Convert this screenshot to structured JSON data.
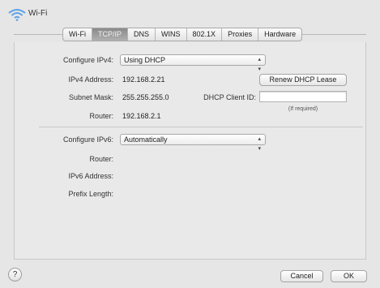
{
  "header": {
    "title": "Wi-Fi",
    "icon": "wifi-icon"
  },
  "tabs": [
    "Wi-Fi",
    "TCP/IP",
    "DNS",
    "WINS",
    "802.1X",
    "Proxies",
    "Hardware"
  ],
  "active_tab": "TCP/IP",
  "ipv4": {
    "configure_label": "Configure IPv4:",
    "configure_value": "Using DHCP",
    "address_label": "IPv4 Address:",
    "address_value": "192.168.2.21",
    "subnet_label": "Subnet Mask:",
    "subnet_value": "255.255.255.0",
    "router_label": "Router:",
    "router_value": "192.168.2.1",
    "renew_button": "Renew DHCP Lease",
    "dhcp_client_id_label": "DHCP Client ID:",
    "dhcp_client_id_value": "",
    "required_note": "(If required)"
  },
  "ipv6": {
    "configure_label": "Configure IPv6:",
    "configure_value": "Automatically",
    "router_label": "Router:",
    "address_label": "IPv6 Address:",
    "prefix_label": "Prefix Length:"
  },
  "footer": {
    "help": "?",
    "cancel": "Cancel",
    "ok": "OK"
  }
}
